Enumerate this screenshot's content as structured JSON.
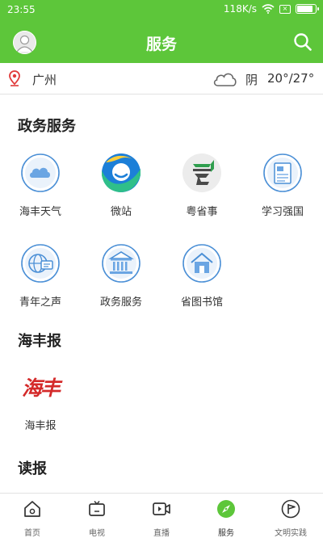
{
  "status_bar": {
    "time": "23:55",
    "speed": "118K/s",
    "battery_level": 0.9
  },
  "header": {
    "title": "服务"
  },
  "location": {
    "city": "广州",
    "weather": "阴",
    "temperature": "20°/27°"
  },
  "sections": {
    "gov": {
      "title": "政务服务",
      "items": [
        {
          "label": "海丰天气",
          "icon": "cloud-icon"
        },
        {
          "label": "微站",
          "icon": "weizhan-icon"
        },
        {
          "label": "粤省事",
          "icon": "yueshengshi-icon"
        },
        {
          "label": "学习强国",
          "icon": "xuexi-icon"
        },
        {
          "label": "青年之声",
          "icon": "globe-icon"
        },
        {
          "label": "政务服务",
          "icon": "government-building-icon"
        },
        {
          "label": "省图书馆",
          "icon": "library-icon"
        }
      ]
    },
    "paper": {
      "title": "海丰报",
      "items": [
        {
          "label": "海丰报",
          "icon": "haifeng-logo",
          "logo_text": "海丰"
        }
      ]
    },
    "read": {
      "title": "读报"
    }
  },
  "nav": [
    {
      "label": "首页",
      "icon": "home-icon"
    },
    {
      "label": "电视",
      "icon": "tv-icon"
    },
    {
      "label": "直播",
      "icon": "live-video-icon"
    },
    {
      "label": "服务",
      "icon": "compass-icon",
      "active": true
    },
    {
      "label": "文明实践",
      "icon": "flag-icon"
    }
  ],
  "colors": {
    "brand_green": "#5dc63a",
    "icon_blue": "#4a8fd6"
  }
}
